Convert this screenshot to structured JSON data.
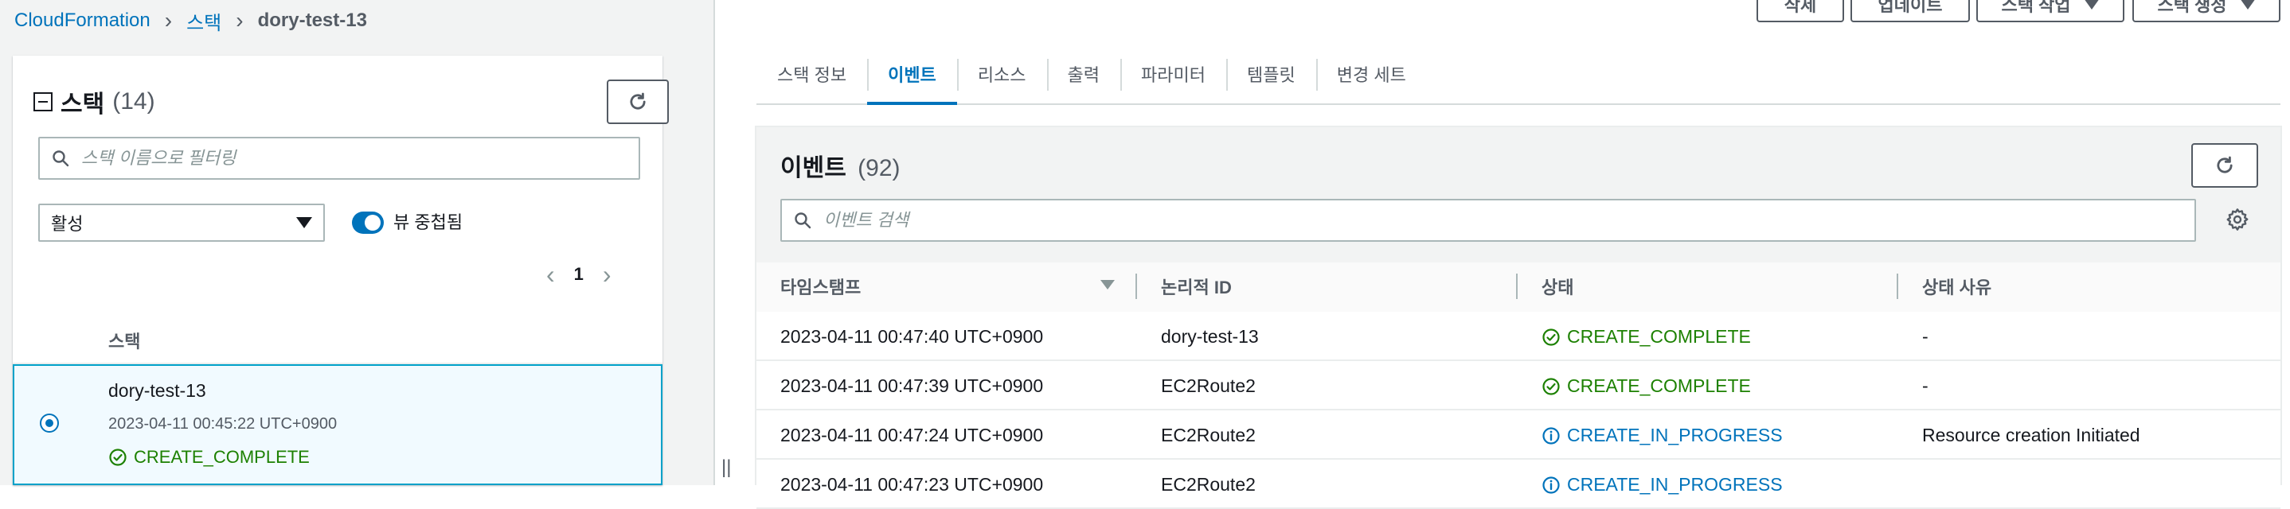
{
  "breadcrumb": {
    "root": "CloudFormation",
    "section": "스택",
    "current": "dory-test-13"
  },
  "stacks_panel": {
    "title": "스택",
    "count": "(14)",
    "search_placeholder": "스택 이름으로 필터링",
    "status_filter": "활성",
    "nested_toggle_label": "뷰 중첩됨",
    "nested_toggle_on": true,
    "page_number": "1",
    "column_header": "스택",
    "selected_stack": {
      "name": "dory-test-13",
      "created": "2023-04-11 00:45:22 UTC+0900",
      "status": "CREATE_COMPLETE"
    }
  },
  "top_buttons": {
    "delete": "삭제",
    "update": "업데이트",
    "stack_actions": "스택 작업",
    "create_stack": "스택 생성"
  },
  "tabs": [
    "스택 정보",
    "이벤트",
    "리소스",
    "출력",
    "파라미터",
    "템플릿",
    "변경 세트"
  ],
  "active_tab_index": 1,
  "events": {
    "title": "이벤트",
    "count": "(92)",
    "search_placeholder": "이벤트 검색",
    "columns": [
      "타임스탬프",
      "논리적 ID",
      "상태",
      "상태 사유"
    ],
    "rows": [
      {
        "timestamp": "2023-04-11 00:47:40 UTC+0900",
        "logical_id": "dory-test-13",
        "status": "CREATE_COMPLETE",
        "reason": "-"
      },
      {
        "timestamp": "2023-04-11 00:47:39 UTC+0900",
        "logical_id": "EC2Route2",
        "status": "CREATE_COMPLETE",
        "reason": "-"
      },
      {
        "timestamp": "2023-04-11 00:47:24 UTC+0900",
        "logical_id": "EC2Route2",
        "status": "CREATE_IN_PROGRESS",
        "reason": "Resource creation Initiated"
      },
      {
        "timestamp": "2023-04-11 00:47:23 UTC+0900",
        "logical_id": "EC2Route2",
        "status": "CREATE_IN_PROGRESS",
        "reason": ""
      }
    ]
  },
  "colors": {
    "accent": "#0073bb",
    "success": "#1d8102",
    "text": "#16191f",
    "muted": "#545b64",
    "selected_row_bg": "#f1faff"
  }
}
